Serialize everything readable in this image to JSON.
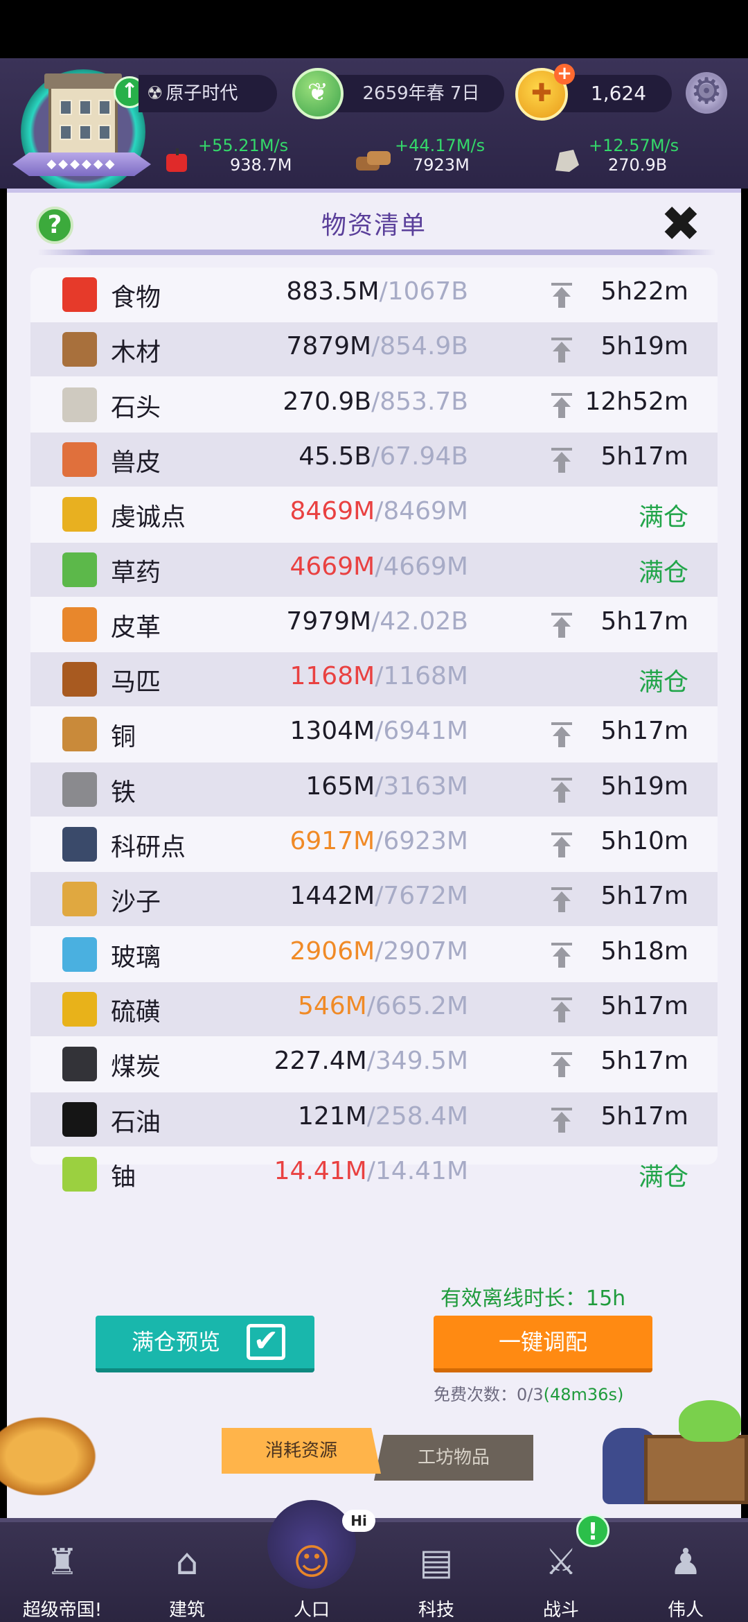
{
  "header": {
    "era": "原子时代",
    "avatar_label": "◆◆◆◆◆◆",
    "date": "2659年春 7日",
    "gold": "1,624",
    "resources": [
      {
        "name": "food",
        "rate": "+55.21M/s",
        "amount": "938.7M",
        "color": "#e02a2a"
      },
      {
        "name": "wood",
        "rate": "+44.17M/s",
        "amount": "7923M",
        "color": "#a26a38"
      },
      {
        "name": "stone",
        "rate": "+12.57M/s",
        "amount": "270.9B",
        "color": "#d4d0c6"
      }
    ]
  },
  "panel": {
    "title": "物资清单",
    "help": "?",
    "close": "✖",
    "items": [
      {
        "name": "食物",
        "current": "883.5M",
        "cap": "/1067B",
        "status": "normal",
        "time": "5h22m",
        "icon": "apple-icon",
        "color": "#e63a2a"
      },
      {
        "name": "木材",
        "current": "7879M",
        "cap": "/854.9B",
        "status": "normal",
        "time": "5h19m",
        "icon": "wood-icon",
        "color": "#a8703c"
      },
      {
        "name": "石头",
        "current": "270.9B",
        "cap": "/853.7B",
        "status": "normal",
        "time": "12h52m",
        "icon": "stone-icon",
        "color": "#cfcac0"
      },
      {
        "name": "兽皮",
        "current": "45.5B",
        "cap": "/67.94B",
        "status": "normal",
        "time": "5h17m",
        "icon": "hide-icon",
        "color": "#e0703c"
      },
      {
        "name": "虔诚点",
        "current": "8469M",
        "cap": "/8469M",
        "status": "red",
        "time": "满仓",
        "icon": "ankh-icon",
        "color": "#e8b020"
      },
      {
        "name": "草药",
        "current": "4669M",
        "cap": "/4669M",
        "status": "red",
        "time": "满仓",
        "icon": "herb-icon",
        "color": "#5cb84a"
      },
      {
        "name": "皮革",
        "current": "7979M",
        "cap": "/42.02B",
        "status": "normal",
        "time": "5h17m",
        "icon": "leather-icon",
        "color": "#e8872c"
      },
      {
        "name": "马匹",
        "current": "1168M",
        "cap": "/1168M",
        "status": "red",
        "time": "满仓",
        "icon": "horse-icon",
        "color": "#a85a20"
      },
      {
        "name": "铜",
        "current": "1304M",
        "cap": "/6941M",
        "status": "normal",
        "time": "5h17m",
        "icon": "copper-icon",
        "color": "#c98a3a"
      },
      {
        "name": "铁",
        "current": "165M",
        "cap": "/3163M",
        "status": "normal",
        "time": "5h19m",
        "icon": "iron-icon",
        "color": "#8a8a8e"
      },
      {
        "name": "科研点",
        "current": "6917M",
        "cap": "/6923M",
        "status": "orange",
        "time": "5h10m",
        "icon": "gears-icon",
        "color": "#3a4a6a"
      },
      {
        "name": "沙子",
        "current": "1442M",
        "cap": "/7672M",
        "status": "normal",
        "time": "5h17m",
        "icon": "sand-icon",
        "color": "#e0a840"
      },
      {
        "name": "玻璃",
        "current": "2906M",
        "cap": "/2907M",
        "status": "orange",
        "time": "5h18m",
        "icon": "glass-icon",
        "color": "#4ab0e0"
      },
      {
        "name": "硫磺",
        "current": "546M",
        "cap": "/665.2M",
        "status": "orange",
        "time": "5h17m",
        "icon": "sulfur-icon",
        "color": "#e8b21a"
      },
      {
        "name": "煤炭",
        "current": "227.4M",
        "cap": "/349.5M",
        "status": "normal",
        "time": "5h17m",
        "icon": "coal-icon",
        "color": "#333338"
      },
      {
        "name": "石油",
        "current": "121M",
        "cap": "/258.4M",
        "status": "normal",
        "time": "5h17m",
        "icon": "oil-drop-icon",
        "color": "#151515"
      },
      {
        "name": "铀",
        "current": "14.41M",
        "cap": "/14.41M",
        "status": "red",
        "time": "满仓",
        "icon": "uranium-icon",
        "color": "#9bd040"
      }
    ],
    "offline_label": "有效离线时长：15h",
    "preview_button": "满仓预览",
    "preview_check": "✔",
    "allocate_button": "一键调配",
    "free_count_label": "免费次数：0/3",
    "free_count_timer": "(48m36s)",
    "tabs": [
      "消耗资源",
      "工坊物品"
    ]
  },
  "nav": {
    "items": [
      {
        "label": "超级帝国!",
        "icon": "castle-icon",
        "glyph": "♜"
      },
      {
        "label": "建筑",
        "icon": "house-icon",
        "glyph": "⌂"
      },
      {
        "label": "人口",
        "icon": "person-icon",
        "glyph": "☺"
      },
      {
        "label": "科技",
        "icon": "book-icon",
        "glyph": "▤"
      },
      {
        "label": "战斗",
        "icon": "swords-icon",
        "glyph": "⚔"
      },
      {
        "label": "伟人",
        "icon": "bust-icon",
        "glyph": "♟"
      }
    ],
    "hi_bubble": "Hi",
    "alert_badge": "!"
  }
}
